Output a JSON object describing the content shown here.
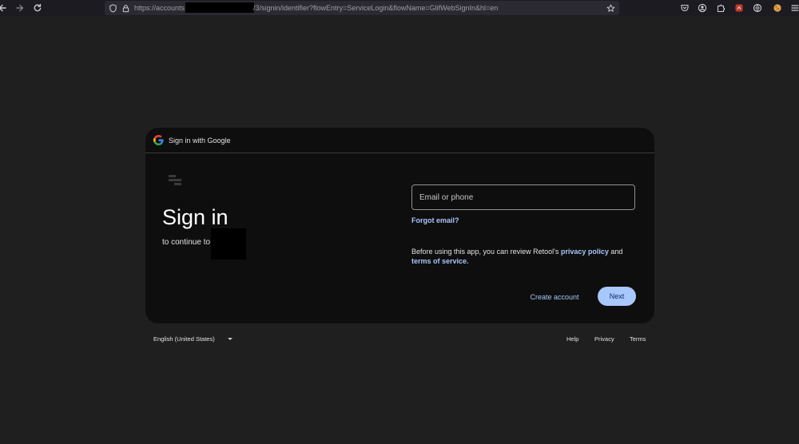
{
  "browser": {
    "url_prefix": "https://accounts",
    "url_suffix": "/3/signin/identifier?flowEntry=ServiceLogin&flowName=GlifWebSignIn&hl=en",
    "icons": {
      "back": "back-arrow-icon",
      "forward": "forward-arrow-icon",
      "reload": "reload-icon",
      "bookmark": "star-icon",
      "menu": "hamburger-menu-icon"
    }
  },
  "card": {
    "header_title": "Sign in with Google",
    "title": "Sign in",
    "continue_text": "to continue to",
    "email": {
      "label": "Email or phone",
      "value": ""
    },
    "forgot_email": "Forgot email?",
    "notice": {
      "before": "Before using this app, you can review Retool's ",
      "privacy_link": "privacy policy",
      "and": " and ",
      "terms_link": "terms of service",
      "after": "."
    },
    "create_account": "Create account",
    "next": "Next"
  },
  "footer": {
    "language": "English (United States)",
    "help": "Help",
    "privacy": "Privacy",
    "terms": "Terms"
  },
  "colors": {
    "page_bg": "#1f1f1f",
    "card_bg": "#0e0e0e",
    "link": "#a8c7fa",
    "primary_button": "#a8c7fa",
    "primary_button_text": "#062e6f"
  }
}
